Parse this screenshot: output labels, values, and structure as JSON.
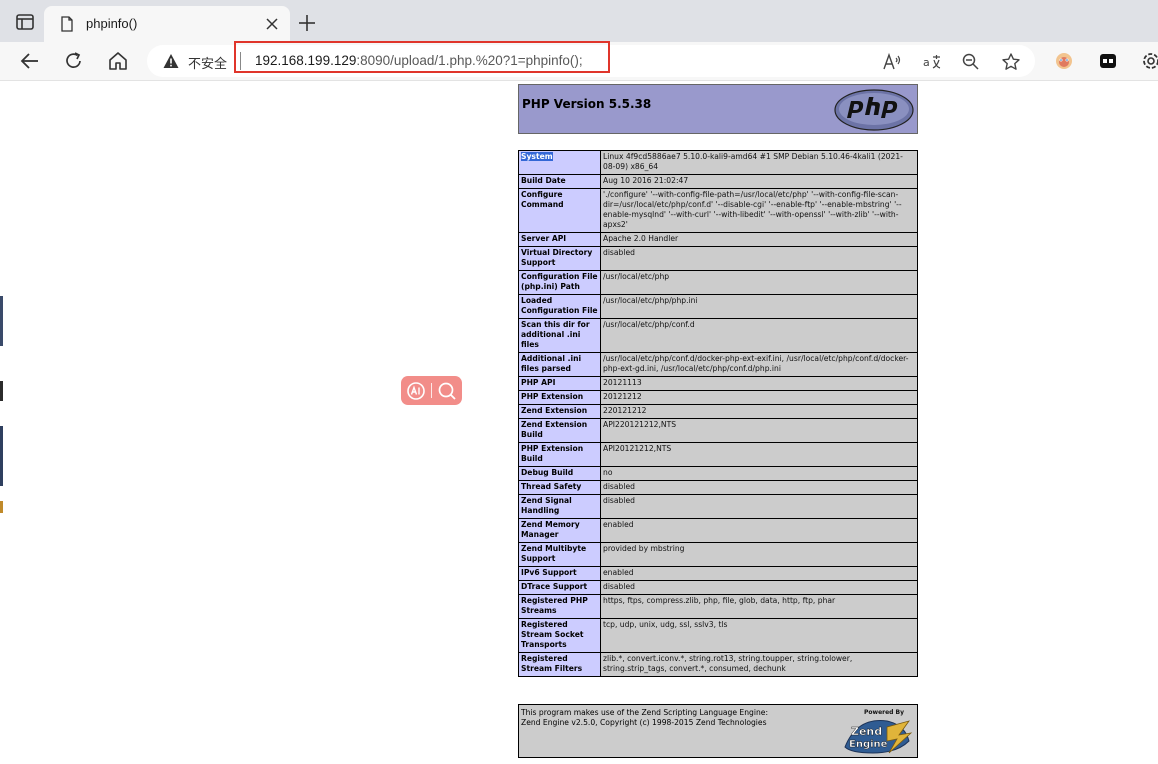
{
  "tab": {
    "title": "phpinfo()"
  },
  "address": {
    "security_label": "不安全",
    "url_host": "192.168.199.129",
    "url_rest": ":8090/upload/1.php.%20?1=phpinfo();"
  },
  "php": {
    "version_title": "PHP Version 5.5.38",
    "rows": [
      {
        "label": "System",
        "value": "Linux 4f9cd5886ae7 5.10.0-kali9-amd64 #1 SMP Debian 5.10.46-4kali1 (2021-08-09) x86_64"
      },
      {
        "label": "Build Date",
        "value": "Aug 10 2016 21:02:47"
      },
      {
        "label": "Configure Command",
        "value": "'./configure' '--with-config-file-path=/usr/local/etc/php' '--with-config-file-scan-dir=/usr/local/etc/php/conf.d' '--disable-cgi' '--enable-ftp' '--enable-mbstring' '--enable-mysqlnd' '--with-curl' '--with-libedit' '--with-openssl' '--with-zlib' '--with-apxs2'"
      },
      {
        "label": "Server API",
        "value": "Apache 2.0 Handler"
      },
      {
        "label": "Virtual Directory Support",
        "value": "disabled"
      },
      {
        "label": "Configuration File (php.ini) Path",
        "value": "/usr/local/etc/php"
      },
      {
        "label": "Loaded Configuration File",
        "value": "/usr/local/etc/php/php.ini"
      },
      {
        "label": "Scan this dir for additional .ini files",
        "value": "/usr/local/etc/php/conf.d"
      },
      {
        "label": "Additional .ini files parsed",
        "value": "/usr/local/etc/php/conf.d/docker-php-ext-exif.ini, /usr/local/etc/php/conf.d/docker-php-ext-gd.ini, /usr/local/etc/php/conf.d/php.ini"
      },
      {
        "label": "PHP API",
        "value": "20121113"
      },
      {
        "label": "PHP Extension",
        "value": "20121212"
      },
      {
        "label": "Zend Extension",
        "value": "220121212"
      },
      {
        "label": "Zend Extension Build",
        "value": "API220121212,NTS"
      },
      {
        "label": "PHP Extension Build",
        "value": "API20121212,NTS"
      },
      {
        "label": "Debug Build",
        "value": "no"
      },
      {
        "label": "Thread Safety",
        "value": "disabled"
      },
      {
        "label": "Zend Signal Handling",
        "value": "disabled"
      },
      {
        "label": "Zend Memory Manager",
        "value": "enabled"
      },
      {
        "label": "Zend Multibyte Support",
        "value": "provided by mbstring"
      },
      {
        "label": "IPv6 Support",
        "value": "enabled"
      },
      {
        "label": "DTrace Support",
        "value": "disabled"
      },
      {
        "label": "Registered PHP Streams",
        "value": "https, ftps, compress.zlib, php, file, glob, data, http, ftp, phar"
      },
      {
        "label": "Registered Stream Socket Transports",
        "value": "tcp, udp, unix, udg, ssl, sslv3, tls"
      },
      {
        "label": "Registered Stream Filters",
        "value": "zlib.*, convert.iconv.*, string.rot13, string.toupper, string.tolower, string.strip_tags, convert.*, consumed, dechunk"
      }
    ],
    "zend_line1": "This program makes use of the Zend Scripting Language Engine:",
    "zend_line2": "Zend Engine v2.5.0, Copyright (c) 1998-2015 Zend Technologies",
    "zend_logo_text": [
      "Powered By",
      "Zend",
      "Engine"
    ]
  },
  "colors": {
    "php_header": "#9999cc",
    "label_cell": "#ccccff",
    "value_cell": "#cccccc",
    "highlight": "#e0352b"
  },
  "icons": [
    "sidebar-icon",
    "php-favicon",
    "close-icon",
    "plus-icon",
    "back-icon",
    "refresh-icon",
    "home-icon",
    "warning-icon",
    "read-aloud-icon",
    "translate-icon",
    "zoom-out-icon",
    "favorite-icon",
    "extension-icon",
    "collections-icon",
    "settings-icon",
    "ai-icon",
    "search-icon"
  ]
}
